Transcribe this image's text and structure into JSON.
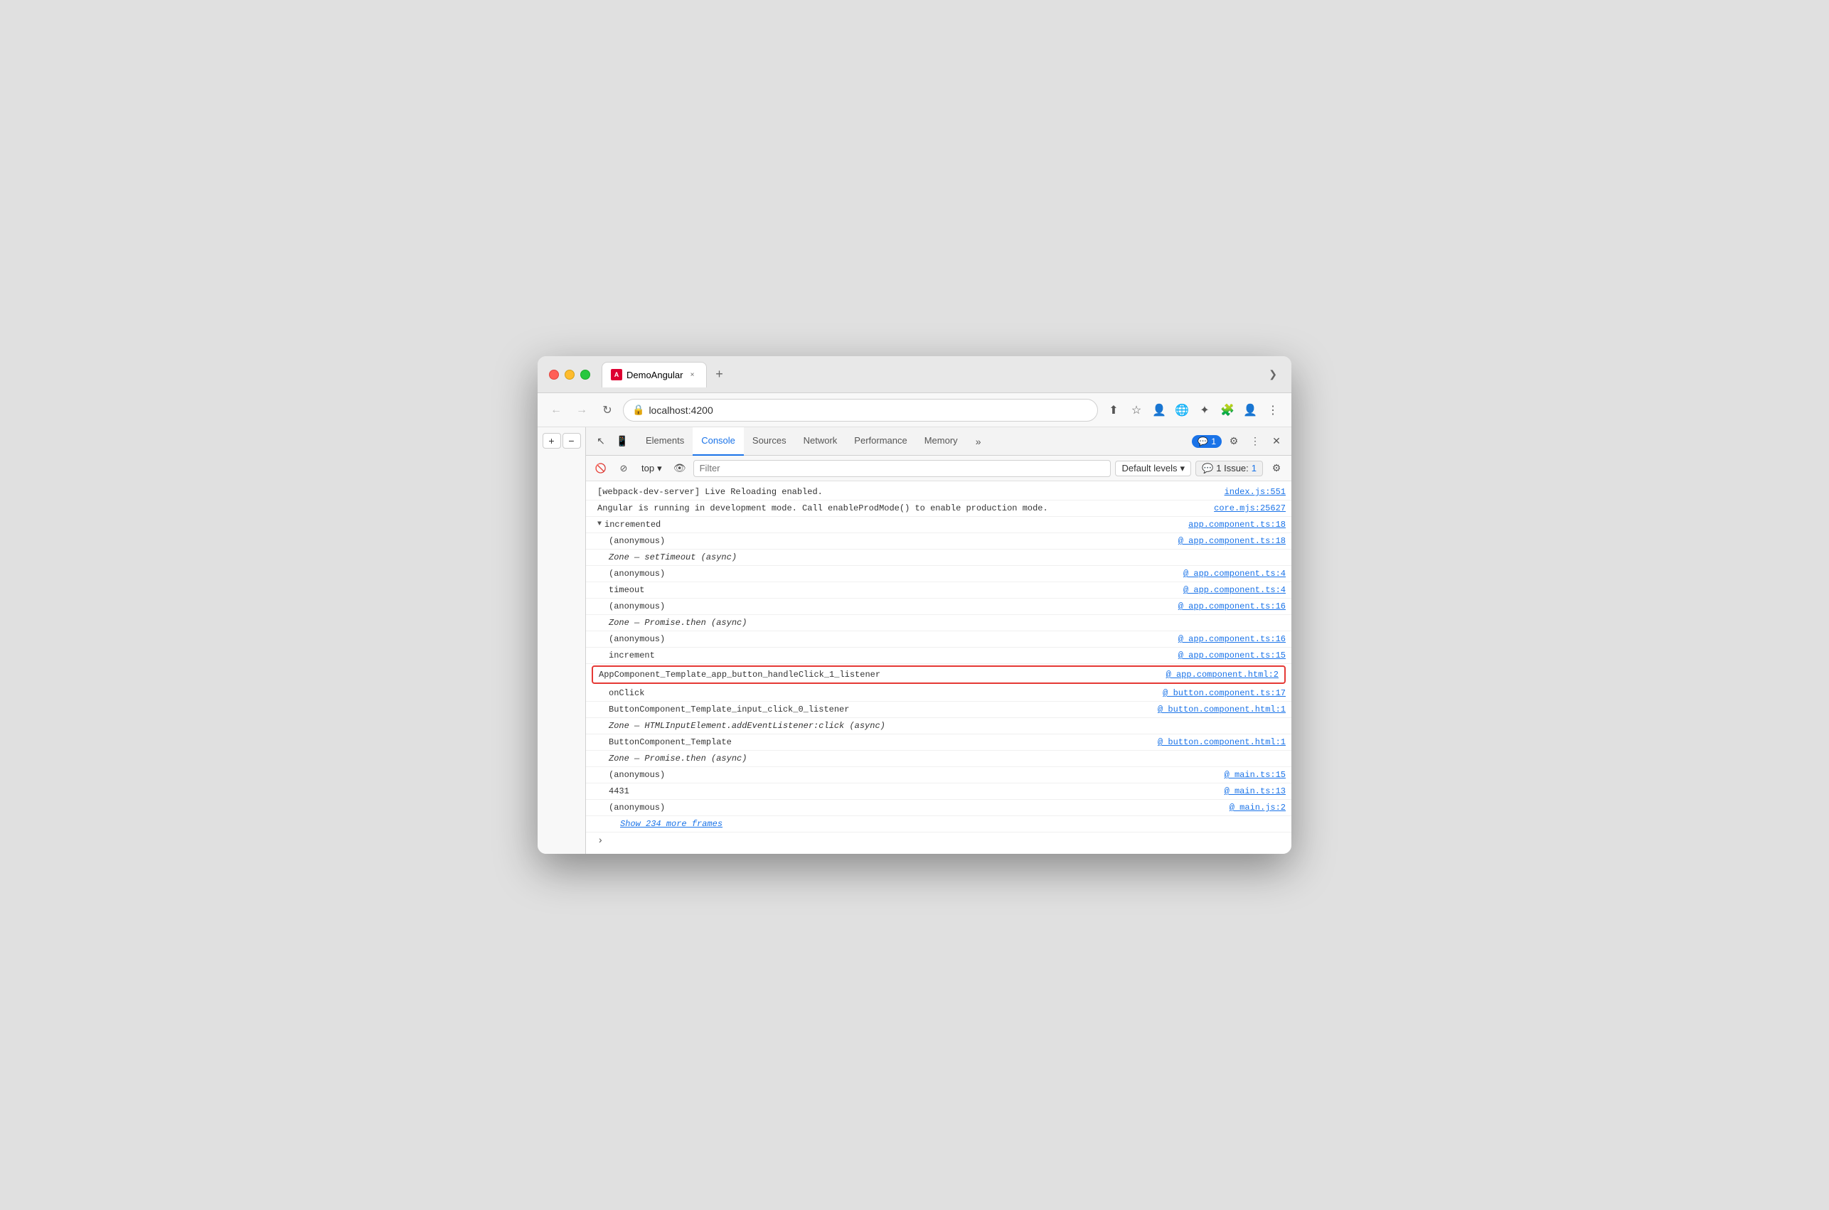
{
  "browser": {
    "tab_title": "DemoAngular",
    "url": "localhost:4200",
    "new_tab_icon": "+",
    "chevron_down": "❯"
  },
  "devtools": {
    "tabs": [
      {
        "label": "Elements",
        "active": false
      },
      {
        "label": "Console",
        "active": true
      },
      {
        "label": "Sources",
        "active": false
      },
      {
        "label": "Network",
        "active": false
      },
      {
        "label": "Performance",
        "active": false
      },
      {
        "label": "Memory",
        "active": false
      }
    ],
    "badge_count": "1",
    "settings_icon": "⚙",
    "more_icon": "⋮",
    "close_icon": "✕"
  },
  "console": {
    "filter_placeholder": "Filter",
    "context_label": "top",
    "default_levels_label": "Default levels",
    "issues_label": "1 Issue:",
    "issues_count": "1",
    "lines": [
      {
        "type": "normal",
        "text": "[webpack-dev-server] Live Reloading enabled.",
        "source": "index.js:551",
        "source_link": true,
        "indent": 0
      },
      {
        "type": "normal",
        "text": "Angular is running in development mode. Call enableProdMode() to enable production mode.",
        "source": "core.mjs:25627",
        "source_link": true,
        "indent": 0,
        "multiline": true
      },
      {
        "type": "group",
        "text": "▼ incremented",
        "source": "app.component.ts:18",
        "source_link": true,
        "indent": 0
      },
      {
        "type": "normal",
        "text": "(anonymous)",
        "source": "app.component.ts:18",
        "source_link": true,
        "at_sign": true,
        "indent": 1
      },
      {
        "type": "async",
        "text": "Zone — setTimeout (async)",
        "indent": 1,
        "italic": true
      },
      {
        "type": "normal",
        "text": "(anonymous)",
        "source": "app.component.ts:4",
        "source_link": true,
        "at_sign": true,
        "indent": 1
      },
      {
        "type": "normal",
        "text": "timeout",
        "source": "app.component.ts:4",
        "source_link": true,
        "at_sign": true,
        "indent": 1
      },
      {
        "type": "normal",
        "text": "(anonymous)",
        "source": "app.component.ts:16",
        "source_link": true,
        "at_sign": true,
        "indent": 1
      },
      {
        "type": "async",
        "text": "Zone — Promise.then (async)",
        "indent": 1,
        "italic": true
      },
      {
        "type": "normal",
        "text": "(anonymous)",
        "source": "app.component.ts:16",
        "source_link": true,
        "at_sign": true,
        "indent": 1
      },
      {
        "type": "normal",
        "text": "increment",
        "source": "app.component.ts:15",
        "source_link": true,
        "at_sign": true,
        "indent": 1
      },
      {
        "type": "highlighted",
        "text": "AppComponent_Template_app_button_handleClick_1_listener",
        "source": "app.component.html:2",
        "source_link": true,
        "at_sign": true,
        "indent": 1
      },
      {
        "type": "normal",
        "text": "onClick",
        "source": "button.component.ts:17",
        "source_link": true,
        "at_sign": true,
        "indent": 1
      },
      {
        "type": "normal",
        "text": "ButtonComponent_Template_input_click_0_listener",
        "source": "button.component.html:1",
        "source_link": true,
        "at_sign": true,
        "indent": 1
      },
      {
        "type": "async",
        "text": "Zone — HTMLInputElement.addEventListener:click (async)",
        "indent": 1,
        "italic": true
      },
      {
        "type": "normal",
        "text": "ButtonComponent_Template",
        "source": "button.component.html:1",
        "source_link": true,
        "at_sign": true,
        "indent": 1
      },
      {
        "type": "async",
        "text": "Zone — Promise.then (async)",
        "indent": 1,
        "italic": true
      },
      {
        "type": "normal",
        "text": "(anonymous)",
        "source": "main.ts:15",
        "source_link": true,
        "at_sign": true,
        "indent": 1
      },
      {
        "type": "normal",
        "text": "4431",
        "source": "main.ts:13",
        "source_link": true,
        "at_sign": true,
        "indent": 1
      },
      {
        "type": "normal",
        "text": "(anonymous)",
        "source": "main.js:2",
        "source_link": true,
        "at_sign": true,
        "indent": 1
      }
    ],
    "show_more_frames": "Show 234 more frames"
  },
  "zoom": {
    "plus_label": "+",
    "minus_label": "−"
  }
}
